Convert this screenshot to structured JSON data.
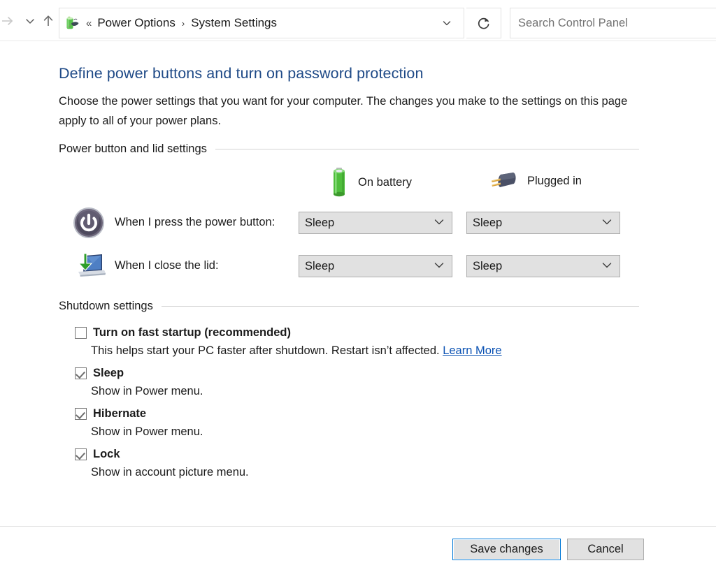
{
  "addressbar": {
    "nav": {
      "forward_icon": "arrow-right-icon",
      "recent_icon": "chevron-down-icon",
      "up_icon": "arrow-up-icon"
    },
    "location_icon": "power-options-icon",
    "separator": "«",
    "crumbs": [
      {
        "label": "Power Options"
      },
      {
        "label": "System Settings"
      }
    ],
    "crumb_arrow": "›",
    "dropdown_icon": "chevron-down-icon",
    "refresh_icon": "refresh-icon",
    "refresh_glyph": "↻",
    "search": {
      "value": "",
      "placeholder": "Search Control Panel"
    }
  },
  "page": {
    "title": "Define power buttons and turn on password protection",
    "description": "Choose the power settings that you want for your computer. The changes you make to the settings on this page apply to all of your power plans.",
    "title_color": "#1f4a87"
  },
  "power_lid_group": {
    "label": "Power button and lid settings",
    "columns": [
      {
        "label": "On battery",
        "icon": "battery-icon"
      },
      {
        "label": "Plugged in",
        "icon": "power-plug-icon"
      }
    ],
    "rows": [
      {
        "icon": "power-button-icon",
        "label": "When I press the power button:",
        "on_battery": "Sleep",
        "plugged_in": "Sleep",
        "chevron": "⌄"
      },
      {
        "icon": "laptop-lid-close-icon",
        "label": "When I close the lid:",
        "on_battery": "Sleep",
        "plugged_in": "Sleep",
        "chevron": "⌄"
      }
    ]
  },
  "shutdown_group": {
    "label": "Shutdown settings",
    "items": [
      {
        "checked": false,
        "title": "Turn on fast startup (recommended)",
        "description": "This helps start your PC faster after shutdown. Restart isn’t affected.",
        "link": "Learn More"
      },
      {
        "checked": true,
        "title": "Sleep",
        "description": "Show in Power menu.",
        "link": ""
      },
      {
        "checked": true,
        "title": "Hibernate",
        "description": "Show in Power menu.",
        "link": ""
      },
      {
        "checked": true,
        "title": "Lock",
        "description": "Show in account picture menu.",
        "link": ""
      }
    ]
  },
  "footer": {
    "save_label": "Save changes",
    "cancel_label": "Cancel",
    "focus_color": "#0078d7"
  }
}
